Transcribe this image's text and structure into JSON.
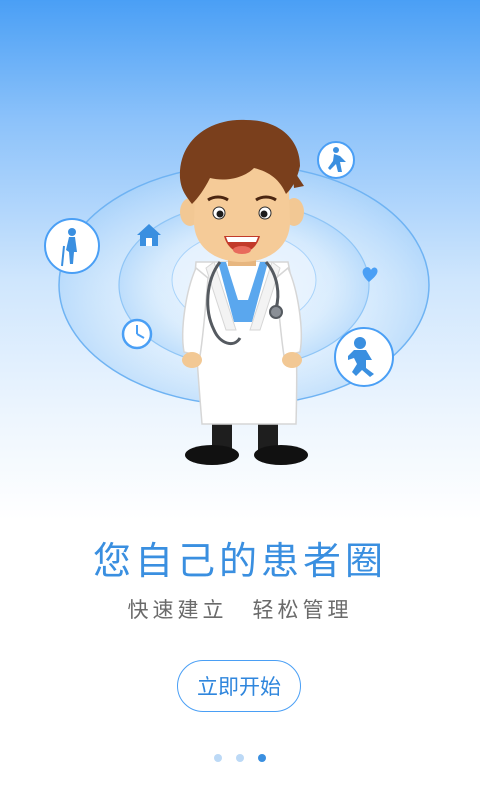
{
  "onboarding": {
    "headline": "您自己的患者圈",
    "subline": "快速建立　轻松管理",
    "start_button": "立即开始",
    "page_indicator": {
      "total": 3,
      "current": 3
    }
  },
  "illustration": {
    "icons": [
      "elderly-person-icon",
      "home-icon",
      "clock-icon",
      "woman-running-icon",
      "heart-icon",
      "child-running-icon"
    ],
    "accent_color": "#4a9ff5",
    "text_color": "#3a8fe0"
  }
}
